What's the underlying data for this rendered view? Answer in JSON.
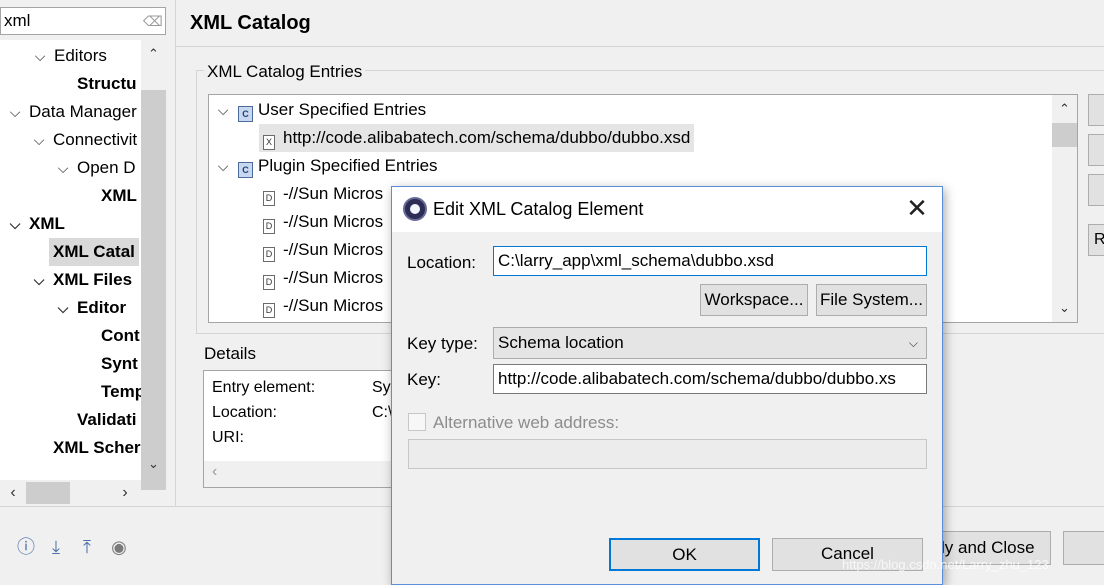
{
  "filter": {
    "value": "xml",
    "clear_icon": "clear-filter-icon"
  },
  "nav_tree": [
    {
      "label": "Editors",
      "twisty": "v"
    },
    {
      "label": "Structu",
      "twisty": ""
    },
    {
      "label": "Data Manager",
      "twisty": "v"
    },
    {
      "label": "Connectivit",
      "twisty": "v"
    },
    {
      "label": "Open D",
      "twisty": "v"
    },
    {
      "label": "XML",
      "twisty": ""
    },
    {
      "label": "XML",
      "twisty": "v"
    },
    {
      "label": "XML Catal",
      "twisty": ""
    },
    {
      "label": "XML Files",
      "twisty": "v"
    },
    {
      "label": "Editor",
      "twisty": "v"
    },
    {
      "label": "Cont",
      "twisty": ""
    },
    {
      "label": "Synt",
      "twisty": ""
    },
    {
      "label": "Temp",
      "twisty": ""
    },
    {
      "label": "Validati",
      "twisty": ""
    },
    {
      "label": "XML Scher",
      "twisty": ""
    }
  ],
  "page": {
    "title": "XML Catalog",
    "entries_group_label": "XML Catalog Entries",
    "entries": [
      {
        "label": "User Specified Entries",
        "icon": "C"
      },
      {
        "label": "http://code.alibabatech.com/schema/dubbo/dubbo.xsd",
        "icon": "X"
      },
      {
        "label": "Plugin Specified Entries",
        "icon": "C"
      },
      {
        "label": "-//Sun Micros",
        "icon": "D"
      },
      {
        "label": "-//Sun Micros",
        "icon": "D"
      },
      {
        "label": "-//Sun Micros",
        "icon": "D"
      },
      {
        "label": "-//Sun Micros",
        "icon": "D"
      },
      {
        "label": "-//Sun Micros",
        "icon": "D"
      }
    ],
    "side_buttons": [
      "",
      "",
      "",
      "R"
    ],
    "details_label": "Details",
    "details": [
      {
        "label": "Entry element:",
        "value": "Sy"
      },
      {
        "label": "Location:",
        "value": "C:\\"
      },
      {
        "label": "URI:",
        "value": ""
      }
    ],
    "apply_close_label": "ly and Close"
  },
  "dialog": {
    "title": "Edit XML Catalog Element",
    "location_label": "Location:",
    "location_value": "C:\\larry_app\\xml_schema\\dubbo.xsd",
    "workspace_button": "Workspace...",
    "filesystem_button": "File System...",
    "key_type_label": "Key type:",
    "key_type_value": "Schema location",
    "key_label": "Key:",
    "key_value": "http://code.alibabatech.com/schema/dubbo/dubbo.xs",
    "alt_web_label": "Alternative web address:",
    "ok_button": "OK",
    "cancel_button": "Cancel"
  },
  "watermark": "https://blog.csdn.net/Larry_zhu_123",
  "colors": {
    "accent": "#0078d7",
    "selection": "#d9d9d9",
    "dialog_border": "#5a8fd8"
  }
}
